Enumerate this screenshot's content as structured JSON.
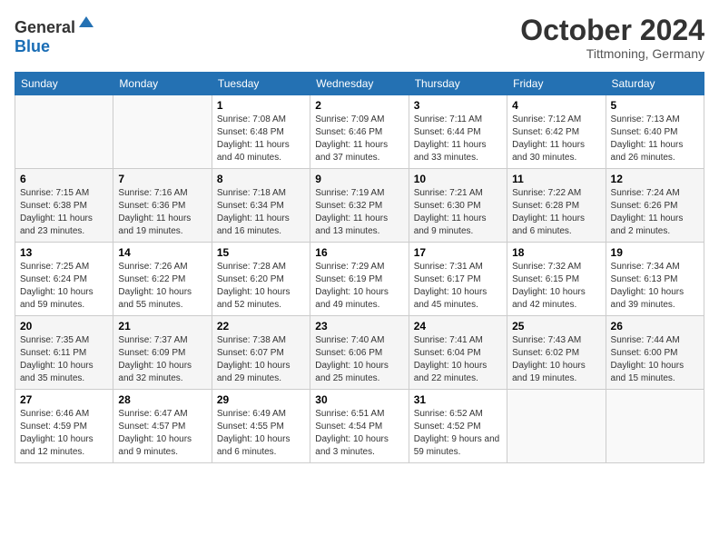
{
  "header": {
    "logo_general": "General",
    "logo_blue": "Blue",
    "month_title": "October 2024",
    "subtitle": "Tittmoning, Germany"
  },
  "weekdays": [
    "Sunday",
    "Monday",
    "Tuesday",
    "Wednesday",
    "Thursday",
    "Friday",
    "Saturday"
  ],
  "weeks": [
    [
      {
        "day": "",
        "sunrise": "",
        "sunset": "",
        "daylight": ""
      },
      {
        "day": "",
        "sunrise": "",
        "sunset": "",
        "daylight": ""
      },
      {
        "day": "1",
        "sunrise": "Sunrise: 7:08 AM",
        "sunset": "Sunset: 6:48 PM",
        "daylight": "Daylight: 11 hours and 40 minutes."
      },
      {
        "day": "2",
        "sunrise": "Sunrise: 7:09 AM",
        "sunset": "Sunset: 6:46 PM",
        "daylight": "Daylight: 11 hours and 37 minutes."
      },
      {
        "day": "3",
        "sunrise": "Sunrise: 7:11 AM",
        "sunset": "Sunset: 6:44 PM",
        "daylight": "Daylight: 11 hours and 33 minutes."
      },
      {
        "day": "4",
        "sunrise": "Sunrise: 7:12 AM",
        "sunset": "Sunset: 6:42 PM",
        "daylight": "Daylight: 11 hours and 30 minutes."
      },
      {
        "day": "5",
        "sunrise": "Sunrise: 7:13 AM",
        "sunset": "Sunset: 6:40 PM",
        "daylight": "Daylight: 11 hours and 26 minutes."
      }
    ],
    [
      {
        "day": "6",
        "sunrise": "Sunrise: 7:15 AM",
        "sunset": "Sunset: 6:38 PM",
        "daylight": "Daylight: 11 hours and 23 minutes."
      },
      {
        "day": "7",
        "sunrise": "Sunrise: 7:16 AM",
        "sunset": "Sunset: 6:36 PM",
        "daylight": "Daylight: 11 hours and 19 minutes."
      },
      {
        "day": "8",
        "sunrise": "Sunrise: 7:18 AM",
        "sunset": "Sunset: 6:34 PM",
        "daylight": "Daylight: 11 hours and 16 minutes."
      },
      {
        "day": "9",
        "sunrise": "Sunrise: 7:19 AM",
        "sunset": "Sunset: 6:32 PM",
        "daylight": "Daylight: 11 hours and 13 minutes."
      },
      {
        "day": "10",
        "sunrise": "Sunrise: 7:21 AM",
        "sunset": "Sunset: 6:30 PM",
        "daylight": "Daylight: 11 hours and 9 minutes."
      },
      {
        "day": "11",
        "sunrise": "Sunrise: 7:22 AM",
        "sunset": "Sunset: 6:28 PM",
        "daylight": "Daylight: 11 hours and 6 minutes."
      },
      {
        "day": "12",
        "sunrise": "Sunrise: 7:24 AM",
        "sunset": "Sunset: 6:26 PM",
        "daylight": "Daylight: 11 hours and 2 minutes."
      }
    ],
    [
      {
        "day": "13",
        "sunrise": "Sunrise: 7:25 AM",
        "sunset": "Sunset: 6:24 PM",
        "daylight": "Daylight: 10 hours and 59 minutes."
      },
      {
        "day": "14",
        "sunrise": "Sunrise: 7:26 AM",
        "sunset": "Sunset: 6:22 PM",
        "daylight": "Daylight: 10 hours and 55 minutes."
      },
      {
        "day": "15",
        "sunrise": "Sunrise: 7:28 AM",
        "sunset": "Sunset: 6:20 PM",
        "daylight": "Daylight: 10 hours and 52 minutes."
      },
      {
        "day": "16",
        "sunrise": "Sunrise: 7:29 AM",
        "sunset": "Sunset: 6:19 PM",
        "daylight": "Daylight: 10 hours and 49 minutes."
      },
      {
        "day": "17",
        "sunrise": "Sunrise: 7:31 AM",
        "sunset": "Sunset: 6:17 PM",
        "daylight": "Daylight: 10 hours and 45 minutes."
      },
      {
        "day": "18",
        "sunrise": "Sunrise: 7:32 AM",
        "sunset": "Sunset: 6:15 PM",
        "daylight": "Daylight: 10 hours and 42 minutes."
      },
      {
        "day": "19",
        "sunrise": "Sunrise: 7:34 AM",
        "sunset": "Sunset: 6:13 PM",
        "daylight": "Daylight: 10 hours and 39 minutes."
      }
    ],
    [
      {
        "day": "20",
        "sunrise": "Sunrise: 7:35 AM",
        "sunset": "Sunset: 6:11 PM",
        "daylight": "Daylight: 10 hours and 35 minutes."
      },
      {
        "day": "21",
        "sunrise": "Sunrise: 7:37 AM",
        "sunset": "Sunset: 6:09 PM",
        "daylight": "Daylight: 10 hours and 32 minutes."
      },
      {
        "day": "22",
        "sunrise": "Sunrise: 7:38 AM",
        "sunset": "Sunset: 6:07 PM",
        "daylight": "Daylight: 10 hours and 29 minutes."
      },
      {
        "day": "23",
        "sunrise": "Sunrise: 7:40 AM",
        "sunset": "Sunset: 6:06 PM",
        "daylight": "Daylight: 10 hours and 25 minutes."
      },
      {
        "day": "24",
        "sunrise": "Sunrise: 7:41 AM",
        "sunset": "Sunset: 6:04 PM",
        "daylight": "Daylight: 10 hours and 22 minutes."
      },
      {
        "day": "25",
        "sunrise": "Sunrise: 7:43 AM",
        "sunset": "Sunset: 6:02 PM",
        "daylight": "Daylight: 10 hours and 19 minutes."
      },
      {
        "day": "26",
        "sunrise": "Sunrise: 7:44 AM",
        "sunset": "Sunset: 6:00 PM",
        "daylight": "Daylight: 10 hours and 15 minutes."
      }
    ],
    [
      {
        "day": "27",
        "sunrise": "Sunrise: 6:46 AM",
        "sunset": "Sunset: 4:59 PM",
        "daylight": "Daylight: 10 hours and 12 minutes."
      },
      {
        "day": "28",
        "sunrise": "Sunrise: 6:47 AM",
        "sunset": "Sunset: 4:57 PM",
        "daylight": "Daylight: 10 hours and 9 minutes."
      },
      {
        "day": "29",
        "sunrise": "Sunrise: 6:49 AM",
        "sunset": "Sunset: 4:55 PM",
        "daylight": "Daylight: 10 hours and 6 minutes."
      },
      {
        "day": "30",
        "sunrise": "Sunrise: 6:51 AM",
        "sunset": "Sunset: 4:54 PM",
        "daylight": "Daylight: 10 hours and 3 minutes."
      },
      {
        "day": "31",
        "sunrise": "Sunrise: 6:52 AM",
        "sunset": "Sunset: 4:52 PM",
        "daylight": "Daylight: 9 hours and 59 minutes."
      },
      {
        "day": "",
        "sunrise": "",
        "sunset": "",
        "daylight": ""
      },
      {
        "day": "",
        "sunrise": "",
        "sunset": "",
        "daylight": ""
      }
    ]
  ]
}
